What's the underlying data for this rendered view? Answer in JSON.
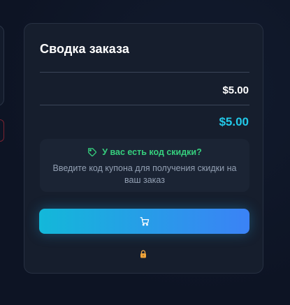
{
  "order_summary": {
    "title": "Сводка заказа",
    "subtotal": "$5.00",
    "total": "$5.00",
    "coupon": {
      "heading": "У вас есть код скидки?",
      "description": "Введите код купона для получения скидки на ваш заказ",
      "icon": "tag-icon"
    },
    "checkout_button": {
      "icon": "cart-icon"
    },
    "secure_icon": "lock-icon"
  },
  "colors": {
    "background": "#0d1424",
    "card": "#161e2d",
    "accent_total": "#22c9e9",
    "coupon_green": "#36d07e",
    "button_gradient_start": "#13b8d9",
    "button_gradient_end": "#3b82f6"
  }
}
